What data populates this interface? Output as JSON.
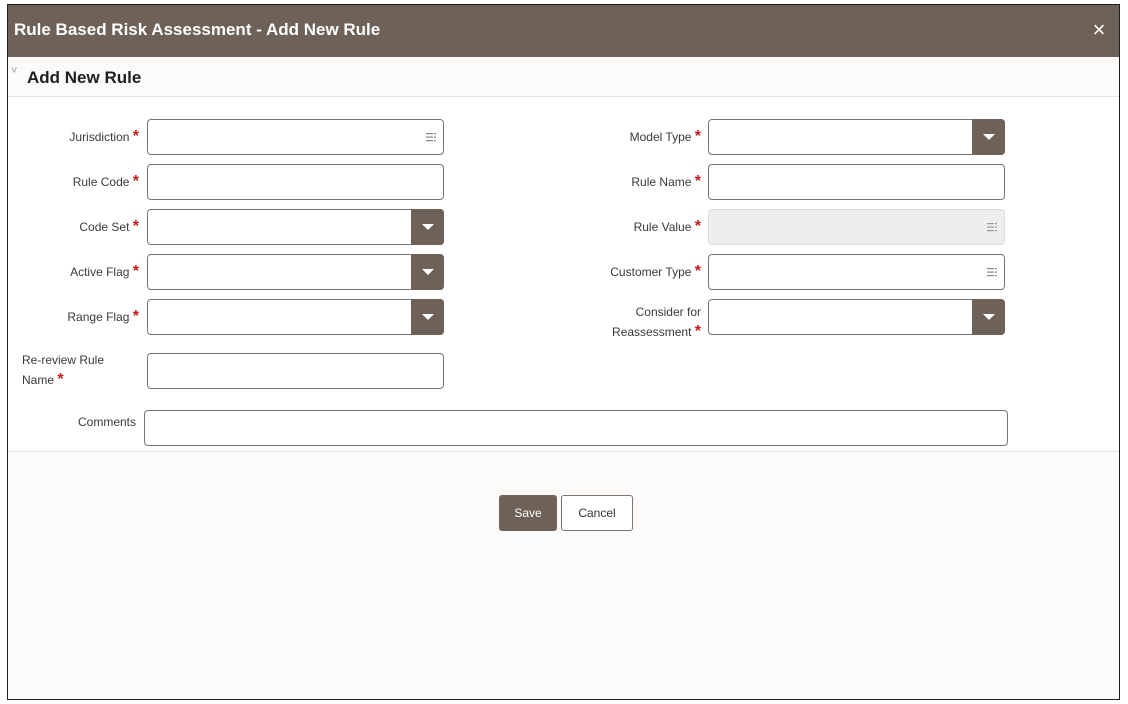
{
  "window": {
    "title": "Rule Based Risk Assessment - Add New Rule",
    "close_glyph": "×"
  },
  "section": {
    "title": "Add New Rule",
    "collapse_glyph": "˅"
  },
  "fields": {
    "jurisdiction": {
      "label": "Jurisdiction",
      "value": "",
      "control": "list-picker"
    },
    "rule_code": {
      "label": "Rule Code",
      "value": "",
      "control": "text"
    },
    "code_set": {
      "label": "Code Set",
      "value": "",
      "control": "dropdown"
    },
    "active_flag": {
      "label": "Active Flag",
      "value": "",
      "control": "dropdown"
    },
    "range_flag": {
      "label": "Range Flag",
      "value": "",
      "control": "dropdown"
    },
    "rereview_rule_name": {
      "label_line1": "Re-review Rule",
      "label_line2": "Name",
      "value": "",
      "control": "text"
    },
    "model_type": {
      "label": "Model Type",
      "value": "",
      "control": "dropdown"
    },
    "rule_name": {
      "label": "Rule Name",
      "value": "",
      "control": "text"
    },
    "rule_value": {
      "label": "Rule Value",
      "value": "",
      "control": "list-picker",
      "disabled": true
    },
    "customer_type": {
      "label": "Customer Type",
      "value": "",
      "control": "list-picker"
    },
    "consider_reassessment": {
      "label_line1": "Consider for",
      "label_line2": "Reassessment",
      "value": "",
      "control": "dropdown"
    },
    "comments": {
      "label": "Comments",
      "value": "",
      "control": "text"
    }
  },
  "required_marker": "*",
  "actions": {
    "save_label": "Save",
    "cancel_label": "Cancel"
  },
  "colors": {
    "titlebar": "#6d6158",
    "required": "#c91818",
    "primary_button": "#6d6158"
  }
}
